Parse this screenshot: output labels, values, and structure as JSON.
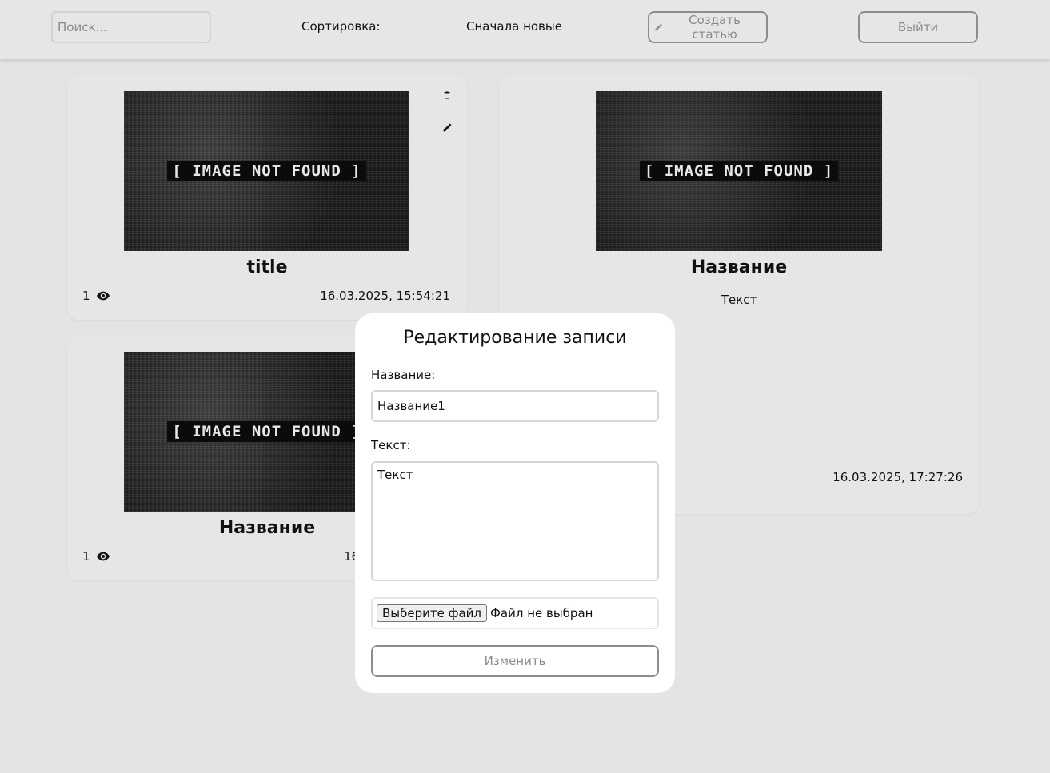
{
  "header": {
    "search_placeholder": "Поиск...",
    "sort_label": "Сортировка:",
    "sort_value": "Сначала новые",
    "create_label": "Создать статью",
    "logout_label": "Выйти"
  },
  "cards": [
    {
      "image_text": "[ IMAGE NOT FOUND ]",
      "title": "title",
      "views": "1",
      "date": "16.03.2025, 15:54:21"
    },
    {
      "image_text": "[ IMAGE NOT FOUND ]",
      "title": "Название",
      "text": "Текст",
      "date": "16.03.2025, 17:27:26"
    },
    {
      "image_text": "[ IMAGE NOT FOUND ]",
      "title": "Название",
      "views": "1",
      "date_partial": "16"
    }
  ],
  "modal": {
    "title": "Редактирование записи",
    "name_label": "Название:",
    "name_value": "Название1",
    "text_label": "Текст:",
    "text_value": "Текст",
    "file_button": "Выберите файл",
    "file_status": "Файл не выбран",
    "submit_label": "Изменить"
  },
  "icons": {
    "delete": "trash-icon",
    "edit": "pencil-icon",
    "views": "eye-icon"
  }
}
